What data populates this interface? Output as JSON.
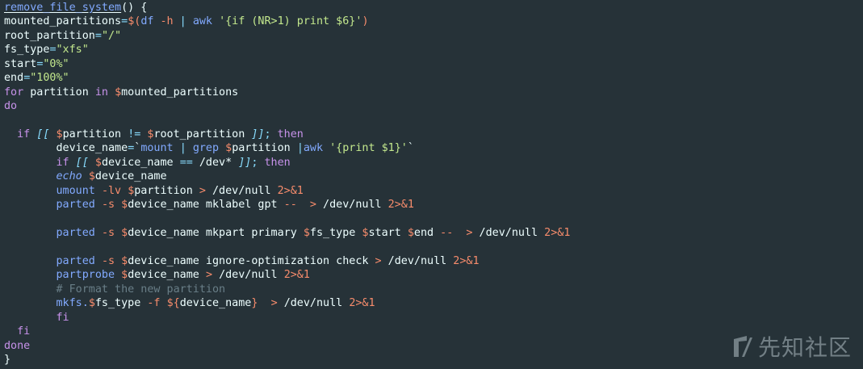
{
  "code_lines": [
    [
      {
        "t": "remove_file_system",
        "c": "func",
        "u": true
      },
      {
        "t": "() {",
        "c": "text"
      }
    ],
    [
      {
        "t": "mounted_partitions",
        "c": "text"
      },
      {
        "t": "=",
        "c": "op"
      },
      {
        "t": "$(",
        "c": "var"
      },
      {
        "t": "df ",
        "c": "cmd"
      },
      {
        "t": "-h",
        "c": "flag"
      },
      {
        "t": " | ",
        "c": "op"
      },
      {
        "t": "awk ",
        "c": "cmd"
      },
      {
        "t": "'{if (NR>1) print $6}'",
        "c": "str"
      },
      {
        "t": ")",
        "c": "var"
      }
    ],
    [
      {
        "t": "root_partition",
        "c": "text"
      },
      {
        "t": "=",
        "c": "op"
      },
      {
        "t": "\"/\"",
        "c": "str"
      }
    ],
    [
      {
        "t": "fs_type",
        "c": "text"
      },
      {
        "t": "=",
        "c": "op"
      },
      {
        "t": "\"xfs\"",
        "c": "str"
      }
    ],
    [
      {
        "t": "start",
        "c": "text"
      },
      {
        "t": "=",
        "c": "op"
      },
      {
        "t": "\"0%\"",
        "c": "str"
      }
    ],
    [
      {
        "t": "end",
        "c": "text"
      },
      {
        "t": "=",
        "c": "op"
      },
      {
        "t": "\"100%\"",
        "c": "str"
      }
    ],
    [
      {
        "t": "for",
        "c": "kw"
      },
      {
        "t": " partition ",
        "c": "text"
      },
      {
        "t": "in",
        "c": "kw"
      },
      {
        "t": " ",
        "c": "text"
      },
      {
        "t": "$",
        "c": "var"
      },
      {
        "t": "mounted_partitions",
        "c": "text"
      }
    ],
    [
      {
        "t": "do",
        "c": "kw"
      }
    ],
    [],
    [
      {
        "t": "  ",
        "c": "text"
      },
      {
        "t": "if",
        "c": "kw"
      },
      {
        "t": " [[ ",
        "c": "op",
        "i": true
      },
      {
        "t": "$",
        "c": "var"
      },
      {
        "t": "partition ",
        "c": "text"
      },
      {
        "t": "!=",
        "c": "op"
      },
      {
        "t": " ",
        "c": "text"
      },
      {
        "t": "$",
        "c": "var"
      },
      {
        "t": "root_partition ",
        "c": "text"
      },
      {
        "t": "]]",
        "c": "op",
        "i": true
      },
      {
        "t": "; ",
        "c": "op"
      },
      {
        "t": "then",
        "c": "kw"
      }
    ],
    [
      {
        "t": "        device_name",
        "c": "text"
      },
      {
        "t": "=",
        "c": "op"
      },
      {
        "t": "`",
        "c": "text"
      },
      {
        "t": "mount ",
        "c": "cmd"
      },
      {
        "t": "| ",
        "c": "op"
      },
      {
        "t": "grep ",
        "c": "cmd"
      },
      {
        "t": "$",
        "c": "var"
      },
      {
        "t": "partition ",
        "c": "text"
      },
      {
        "t": "|",
        "c": "op"
      },
      {
        "t": "awk ",
        "c": "cmd"
      },
      {
        "t": "'{print $1}'",
        "c": "str"
      },
      {
        "t": "`",
        "c": "text"
      }
    ],
    [
      {
        "t": "        ",
        "c": "text"
      },
      {
        "t": "if",
        "c": "kw"
      },
      {
        "t": " [[ ",
        "c": "op",
        "i": true
      },
      {
        "t": "$",
        "c": "var"
      },
      {
        "t": "device_name ",
        "c": "text"
      },
      {
        "t": "==",
        "c": "op"
      },
      {
        "t": " /dev* ",
        "c": "text"
      },
      {
        "t": "]]",
        "c": "op",
        "i": true
      },
      {
        "t": "; ",
        "c": "op"
      },
      {
        "t": "then",
        "c": "kw"
      }
    ],
    [
      {
        "t": "        ",
        "c": "text"
      },
      {
        "t": "echo",
        "c": "cmd",
        "i": true
      },
      {
        "t": " ",
        "c": "text"
      },
      {
        "t": "$",
        "c": "var"
      },
      {
        "t": "device_name",
        "c": "text"
      }
    ],
    [
      {
        "t": "        ",
        "c": "text"
      },
      {
        "t": "umount ",
        "c": "cmd"
      },
      {
        "t": "-lv ",
        "c": "flag"
      },
      {
        "t": "$",
        "c": "var"
      },
      {
        "t": "partition ",
        "c": "text"
      },
      {
        "t": "> ",
        "c": "var"
      },
      {
        "t": "/dev/null ",
        "c": "text"
      },
      {
        "t": "2>&1",
        "c": "var"
      }
    ],
    [
      {
        "t": "        ",
        "c": "text"
      },
      {
        "t": "parted ",
        "c": "cmd"
      },
      {
        "t": "-s ",
        "c": "flag"
      },
      {
        "t": "$",
        "c": "var"
      },
      {
        "t": "device_name mklabel gpt ",
        "c": "text"
      },
      {
        "t": "--",
        "c": "flag"
      },
      {
        "t": "  ",
        "c": "text"
      },
      {
        "t": "> ",
        "c": "var"
      },
      {
        "t": "/dev/null ",
        "c": "text"
      },
      {
        "t": "2>&1",
        "c": "var"
      }
    ],
    [],
    [
      {
        "t": "        ",
        "c": "text"
      },
      {
        "t": "parted ",
        "c": "cmd"
      },
      {
        "t": "-s ",
        "c": "flag"
      },
      {
        "t": "$",
        "c": "var"
      },
      {
        "t": "device_name mkpart primary ",
        "c": "text"
      },
      {
        "t": "$",
        "c": "var"
      },
      {
        "t": "fs_type ",
        "c": "text"
      },
      {
        "t": "$",
        "c": "var"
      },
      {
        "t": "start ",
        "c": "text"
      },
      {
        "t": "$",
        "c": "var"
      },
      {
        "t": "end ",
        "c": "text"
      },
      {
        "t": "--",
        "c": "flag"
      },
      {
        "t": "  ",
        "c": "text"
      },
      {
        "t": "> ",
        "c": "var"
      },
      {
        "t": "/dev/null ",
        "c": "text"
      },
      {
        "t": "2>&1",
        "c": "var"
      }
    ],
    [],
    [
      {
        "t": "        ",
        "c": "text"
      },
      {
        "t": "parted ",
        "c": "cmd"
      },
      {
        "t": "-s ",
        "c": "flag"
      },
      {
        "t": "$",
        "c": "var"
      },
      {
        "t": "device_name ignore-optimization check ",
        "c": "text"
      },
      {
        "t": "> ",
        "c": "var"
      },
      {
        "t": "/dev/null ",
        "c": "text"
      },
      {
        "t": "2>&1",
        "c": "var"
      }
    ],
    [
      {
        "t": "        ",
        "c": "text"
      },
      {
        "t": "partprobe ",
        "c": "cmd"
      },
      {
        "t": "$",
        "c": "var"
      },
      {
        "t": "device_name ",
        "c": "text"
      },
      {
        "t": "> ",
        "c": "var"
      },
      {
        "t": "/dev/null ",
        "c": "text"
      },
      {
        "t": "2>&1",
        "c": "var"
      }
    ],
    [
      {
        "t": "        # Format the new partition",
        "c": "com"
      }
    ],
    [
      {
        "t": "        ",
        "c": "text"
      },
      {
        "t": "mkfs.",
        "c": "cmd"
      },
      {
        "t": "$",
        "c": "var"
      },
      {
        "t": "fs_type ",
        "c": "text"
      },
      {
        "t": "-f ",
        "c": "flag"
      },
      {
        "t": "${",
        "c": "var"
      },
      {
        "t": "device_name",
        "c": "text"
      },
      {
        "t": "}",
        "c": "var"
      },
      {
        "t": "  ",
        "c": "text"
      },
      {
        "t": "> ",
        "c": "var"
      },
      {
        "t": "/dev/null ",
        "c": "text"
      },
      {
        "t": "2>&1",
        "c": "var"
      }
    ],
    [
      {
        "t": "        ",
        "c": "text"
      },
      {
        "t": "fi",
        "c": "kw"
      }
    ],
    [
      {
        "t": "  ",
        "c": "text"
      },
      {
        "t": "fi",
        "c": "kw"
      }
    ],
    [
      {
        "t": "done",
        "c": "kw"
      }
    ],
    [
      {
        "t": "}",
        "c": "text"
      }
    ]
  ],
  "watermark": {
    "text": "先知社区",
    "icon": "xianzhi-logo-icon"
  },
  "colors": {
    "background": "#263238",
    "text": "#eeffff",
    "keyword": "#c792ea",
    "string": "#c3e88d",
    "variable": "#f78c6c",
    "command": "#82aaff",
    "operator": "#89ddff",
    "comment": "#697e87"
  }
}
